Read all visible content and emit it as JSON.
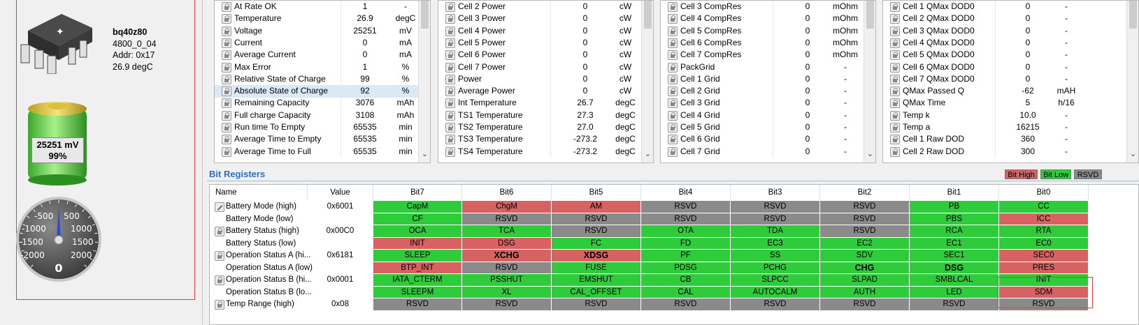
{
  "device": {
    "name": "bq40z80",
    "fw": "4800_0_04",
    "addr": "Addr: 0x17",
    "temp": "26.9 degC",
    "battery_mv": "25251 mV",
    "battery_pct": "99%",
    "gauge_labels": [
      "-500",
      "500",
      "-1000",
      "1000",
      "-1500",
      "1500",
      "-2000",
      "2000"
    ],
    "gauge_value": "0"
  },
  "table1": [
    {
      "name": "At Rate OK",
      "value": "1",
      "unit": "-"
    },
    {
      "name": "Temperature",
      "value": "26.9",
      "unit": "degC"
    },
    {
      "name": "Voltage",
      "value": "25251",
      "unit": "mV"
    },
    {
      "name": "Current",
      "value": "0",
      "unit": "mA"
    },
    {
      "name": "Average Current",
      "value": "0",
      "unit": "mA"
    },
    {
      "name": "Max Error",
      "value": "1",
      "unit": "%"
    },
    {
      "name": "Relative State of Charge",
      "value": "99",
      "unit": "%"
    },
    {
      "name": "Absolute State of Charge",
      "value": "92",
      "unit": "%"
    },
    {
      "name": "Remaining Capacity",
      "value": "3076",
      "unit": "mAh"
    },
    {
      "name": "Full charge Capacity",
      "value": "3108",
      "unit": "mAh"
    },
    {
      "name": "Run time To Empty",
      "value": "65535",
      "unit": "min"
    },
    {
      "name": "Average Time to Empty",
      "value": "65535",
      "unit": "min"
    },
    {
      "name": "Average Time to Full",
      "value": "65535",
      "unit": "min"
    }
  ],
  "table2": [
    {
      "name": "Cell 2 Power",
      "value": "0",
      "unit": "cW"
    },
    {
      "name": "Cell 3 Power",
      "value": "0",
      "unit": "cW"
    },
    {
      "name": "Cell 4 Power",
      "value": "0",
      "unit": "cW"
    },
    {
      "name": "Cell 5 Power",
      "value": "0",
      "unit": "cW"
    },
    {
      "name": "Cell 6 Power",
      "value": "0",
      "unit": "cW"
    },
    {
      "name": "Cell 7 Power",
      "value": "0",
      "unit": "cW"
    },
    {
      "name": "Power",
      "value": "0",
      "unit": "cW"
    },
    {
      "name": "Average Power",
      "value": "0",
      "unit": "cW"
    },
    {
      "name": "Int Temperature",
      "value": "26.7",
      "unit": "degC"
    },
    {
      "name": "TS1 Temperature",
      "value": "27.3",
      "unit": "degC"
    },
    {
      "name": "TS2 Temperature",
      "value": "27.0",
      "unit": "degC"
    },
    {
      "name": "TS3 Temperature",
      "value": "-273.2",
      "unit": "degC"
    },
    {
      "name": "TS4 Temperature",
      "value": "-273.2",
      "unit": "degC"
    }
  ],
  "table3": [
    {
      "name": "Cell 3 CompRes",
      "value": "0",
      "unit": "mOhm"
    },
    {
      "name": "Cell 4 CompRes",
      "value": "0",
      "unit": "mOhm"
    },
    {
      "name": "Cell 5 CompRes",
      "value": "0",
      "unit": "mOhm"
    },
    {
      "name": "Cell 6 CompRes",
      "value": "0",
      "unit": "mOhm"
    },
    {
      "name": "Cell 7 CompRes",
      "value": "0",
      "unit": "mOhm"
    },
    {
      "name": "PackGrid",
      "value": "0",
      "unit": "-"
    },
    {
      "name": "Cell 1 Grid",
      "value": "0",
      "unit": "-"
    },
    {
      "name": "Cell 2 Grid",
      "value": "0",
      "unit": "-"
    },
    {
      "name": "Cell 3 Grid",
      "value": "0",
      "unit": "-"
    },
    {
      "name": "Cell 4 Grid",
      "value": "0",
      "unit": "-"
    },
    {
      "name": "Cell 5 Grid",
      "value": "0",
      "unit": "-"
    },
    {
      "name": "Cell 6 Grid",
      "value": "0",
      "unit": "-"
    },
    {
      "name": "Cell 7 Grid",
      "value": "0",
      "unit": "-"
    }
  ],
  "table4": [
    {
      "name": "Cell 1 QMax DOD0",
      "value": "0",
      "unit": "-"
    },
    {
      "name": "Cell 2 QMax DOD0",
      "value": "0",
      "unit": "-"
    },
    {
      "name": "Cell 3 QMax DOD0",
      "value": "0",
      "unit": "-"
    },
    {
      "name": "Cell 4 QMax DOD0",
      "value": "0",
      "unit": "-"
    },
    {
      "name": "Cell 5 QMax DOD0",
      "value": "0",
      "unit": "-"
    },
    {
      "name": "Cell 6 QMax DOD0",
      "value": "0",
      "unit": "-"
    },
    {
      "name": "Cell 7 QMax DOD0",
      "value": "0",
      "unit": "-"
    },
    {
      "name": "QMax Passed Q",
      "value": "-62",
      "unit": "mAH"
    },
    {
      "name": "QMax Time",
      "value": "5",
      "unit": "h/16"
    },
    {
      "name": "Temp k",
      "value": "10.0",
      "unit": "-"
    },
    {
      "name": "Temp a",
      "value": "16215",
      "unit": "-"
    },
    {
      "name": "Cell 1 Raw DOD",
      "value": "360",
      "unit": "-"
    },
    {
      "name": "Cell 2 Raw DOD",
      "value": "300",
      "unit": "-"
    }
  ],
  "bitreg": {
    "title": "Bit Registers",
    "legend": {
      "high": "Bit High",
      "low": "Bit Low",
      "rsvd": "RSVD"
    },
    "headers": [
      "Name",
      "Value",
      "Bit7",
      "Bit6",
      "Bit5",
      "Bit4",
      "Bit3",
      "Bit2",
      "Bit1",
      "Bit0"
    ],
    "rows": [
      {
        "name": "Battery Mode (high)",
        "value": "0x6001",
        "icon": "edit",
        "bits": [
          [
            "CapM",
            "g"
          ],
          [
            "ChgM",
            "r"
          ],
          [
            "AM",
            "r"
          ],
          [
            "RSVD",
            "x"
          ],
          [
            "RSVD",
            "x"
          ],
          [
            "RSVD",
            "x"
          ],
          [
            "PB",
            "g"
          ],
          [
            "CC",
            "g"
          ]
        ]
      },
      {
        "name": "Battery Mode (low)",
        "value": "",
        "icon": "",
        "bits": [
          [
            "CF",
            "g"
          ],
          [
            "RSVD",
            "x"
          ],
          [
            "RSVD",
            "x"
          ],
          [
            "RSVD",
            "x"
          ],
          [
            "RSVD",
            "x"
          ],
          [
            "RSVD",
            "x"
          ],
          [
            "PBS",
            "g"
          ],
          [
            "ICC",
            "r"
          ]
        ]
      },
      {
        "name": "Battery Status (high)",
        "value": "0x00C0",
        "icon": "lock",
        "bits": [
          [
            "OCA",
            "g"
          ],
          [
            "TCA",
            "g"
          ],
          [
            "RSVD",
            "x"
          ],
          [
            "OTA",
            "g"
          ],
          [
            "TDA",
            "g"
          ],
          [
            "RSVD",
            "x"
          ],
          [
            "RCA",
            "g"
          ],
          [
            "RTA",
            "g"
          ]
        ]
      },
      {
        "name": "Battery Status (low)",
        "value": "",
        "icon": "",
        "bits": [
          [
            "INIT",
            "r"
          ],
          [
            "DSG",
            "r"
          ],
          [
            "FC",
            "g"
          ],
          [
            "FD",
            "g"
          ],
          [
            "EC3",
            "g"
          ],
          [
            "EC2",
            "g"
          ],
          [
            "EC1",
            "g"
          ],
          [
            "EC0",
            "g"
          ]
        ]
      },
      {
        "name": "Operation Status A (hi...",
        "value": "0x6181",
        "icon": "lock",
        "bits": [
          [
            "SLEEP",
            "g"
          ],
          [
            "XCHG",
            "r",
            "b"
          ],
          [
            "XDSG",
            "r",
            "b"
          ],
          [
            "PF",
            "g"
          ],
          [
            "SS",
            "g"
          ],
          [
            "SDV",
            "g"
          ],
          [
            "SEC1",
            "g"
          ],
          [
            "SEC0",
            "r"
          ]
        ]
      },
      {
        "name": "Operation Status A (low)",
        "value": "",
        "icon": "",
        "bits": [
          [
            "BTP_INT",
            "r"
          ],
          [
            "RSVD",
            "x"
          ],
          [
            "FUSE",
            "g"
          ],
          [
            "PDSG",
            "g"
          ],
          [
            "PCHG",
            "g"
          ],
          [
            "CHG",
            "g",
            "b"
          ],
          [
            "DSG",
            "g",
            "b"
          ],
          [
            "PRES",
            "r"
          ]
        ]
      },
      {
        "name": "Operation Status B (hi...",
        "value": "0x0001",
        "icon": "lock",
        "bits": [
          [
            "IATA_CTERM",
            "g"
          ],
          [
            "PSSHUT",
            "g"
          ],
          [
            "EMSHUT",
            "g"
          ],
          [
            "CB",
            "g"
          ],
          [
            "SLPCC",
            "g"
          ],
          [
            "SLPAD",
            "g"
          ],
          [
            "SMBLCAL",
            "g"
          ],
          [
            "INIT",
            "g"
          ]
        ]
      },
      {
        "name": "Operation Status B (lo...",
        "value": "",
        "icon": "",
        "bits": [
          [
            "SLEEPM",
            "g"
          ],
          [
            "XL",
            "g"
          ],
          [
            "CAL_OFFSET",
            "g"
          ],
          [
            "CAL",
            "g"
          ],
          [
            "AUTOCALM",
            "g"
          ],
          [
            "AUTH",
            "g"
          ],
          [
            "LED",
            "g"
          ],
          [
            "SDM",
            "r"
          ]
        ]
      },
      {
        "name": "Temp Range (high)",
        "value": "0x08",
        "icon": "lock",
        "bits": [
          [
            "RSVD",
            "x"
          ],
          [
            "RSVD",
            "x"
          ],
          [
            "RSVD",
            "x"
          ],
          [
            "RSVD",
            "x"
          ],
          [
            "RSVD",
            "x"
          ],
          [
            "RSVD",
            "x"
          ],
          [
            "RSVD",
            "x"
          ],
          [
            "RSVD",
            "x"
          ]
        ]
      }
    ]
  },
  "colors": {
    "bit_high": "#d86262",
    "bit_low": "#2ecc3a",
    "rsvd": "#8a8a8a",
    "accent": "#2a6fc4"
  }
}
